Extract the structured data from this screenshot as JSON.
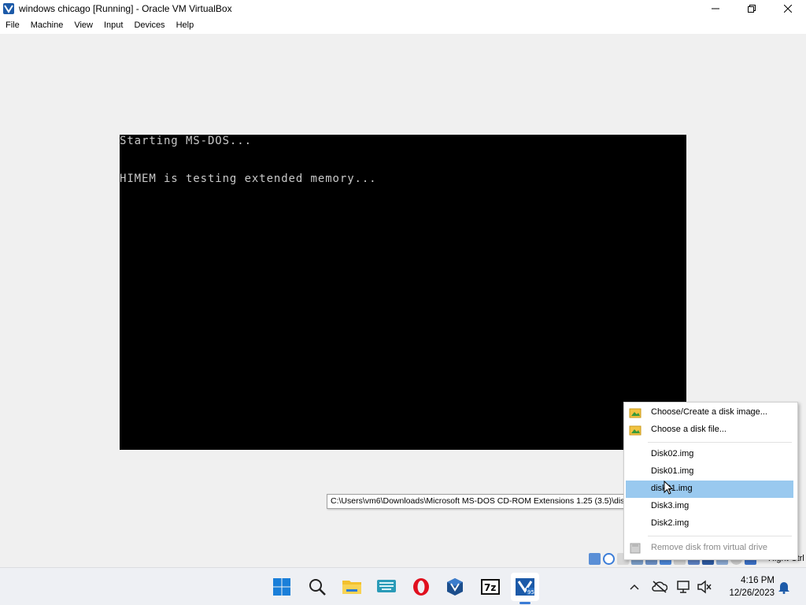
{
  "window": {
    "title": "windows chicago [Running] - Oracle VM VirtualBox"
  },
  "menu": [
    "File",
    "Machine",
    "View",
    "Input",
    "Devices",
    "Help"
  ],
  "vm_console": {
    "lines": [
      "Starting MS-DOS...",
      "HIMEM is testing extended memory..."
    ]
  },
  "context_menu": {
    "choose_create": "Choose/Create a disk image...",
    "choose_file": "Choose a disk file...",
    "recent": [
      "Disk02.img",
      "Disk01.img",
      "disk01.img",
      "Disk3.img",
      "Disk2.img"
    ],
    "selected_index": 2,
    "remove": "Remove disk from virtual drive"
  },
  "tooltip": {
    "text": "C:\\Users\\vm6\\Downloads\\Microsoft MS-DOS CD-ROM Extensions 1.25 (3.5)\\disk01.img"
  },
  "statusbar": {
    "host_key": "Right Ctrl",
    "icons": [
      "hard-disk-icon",
      "optical-drive-icon",
      "floppy-drive-icon",
      "audio-icon",
      "network-icon",
      "usb-icon",
      "shared-folders-icon",
      "display-icon",
      "video-capture-icon",
      "cpu-icon",
      "mouse-integration-icon",
      "host-key-icon"
    ]
  },
  "taskbar": {
    "apps": [
      "start-button",
      "search-button",
      "file-explorer",
      "keyboard-app",
      "opera-browser",
      "virtualbox-manager",
      "7zip",
      "virtualbox-vm-windows95"
    ],
    "time": "4:16 PM",
    "date": "12/26/2023"
  },
  "colors": {
    "menu_highlight": "#99c9ef",
    "vm_text": "#c8c8c8",
    "taskbar_bg": "#eef0f4"
  }
}
